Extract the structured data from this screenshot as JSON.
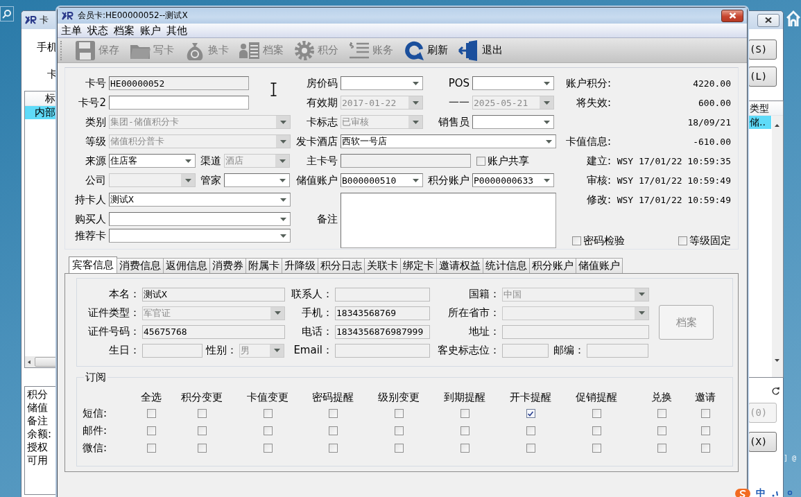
{
  "desktop": {
    "fragment": "] @",
    "ime": {
      "label": "中"
    }
  },
  "back_window": {
    "title": "卡",
    "left": {
      "labels": [
        "手机",
        "卡"
      ],
      "table": {
        "header": "标",
        "rows": [
          {
            "text": "内部",
            "selected": true
          }
        ]
      },
      "info_lines": [
        "积分",
        "储值",
        "备注",
        "余额:",
        "授权",
        "可用"
      ]
    },
    "right": {
      "top_buttons": [
        {
          "label": "(S)",
          "disabled": false
        },
        {
          "label": "(L)",
          "disabled": false
        }
      ],
      "table": {
        "header": "类型",
        "rows": [
          {
            "text": "储..",
            "selected": true
          }
        ]
      },
      "bottom_buttons": [
        {
          "label": "(0)",
          "disabled": true
        },
        {
          "label": "(X)",
          "disabled": false
        }
      ]
    }
  },
  "window": {
    "title": "会员卡:HE00000052--测试X"
  },
  "menu": [
    "主单",
    "状态",
    "档案",
    "账户",
    "其他"
  ],
  "toolbar": [
    {
      "label": "保存",
      "kind": "save",
      "disabled": true
    },
    {
      "label": "写卡",
      "kind": "folder",
      "disabled": true
    },
    {
      "label": "换卡",
      "kind": "bag",
      "disabled": true
    },
    {
      "label": "档案",
      "kind": "profile",
      "disabled": true
    },
    {
      "label": "积分",
      "kind": "gear",
      "disabled": true
    },
    {
      "label": "账务",
      "kind": "ledger",
      "disabled": true
    },
    {
      "label": "刷新",
      "kind": "refresh",
      "disabled": false
    },
    {
      "label": "退出",
      "kind": "exit",
      "disabled": false
    }
  ],
  "form": {
    "left": [
      [
        {
          "label": "卡号",
          "kind": "text",
          "value": "HE00000052",
          "readonly": true,
          "disabled": false
        }
      ],
      [
        {
          "label": "卡号2",
          "kind": "text",
          "readonly": false,
          "disabled": false
        }
      ],
      [
        {
          "label": "类别",
          "kind": "combo",
          "value": "集团-储值积分卡",
          "disabled": true
        }
      ],
      [
        {
          "label": "等级",
          "kind": "combo",
          "value": "储值积分普卡",
          "disabled": true
        }
      ],
      [
        {
          "label": "来源",
          "kind": "combo",
          "value": "住店客",
          "disabled": false
        },
        {
          "label": "渠道",
          "kind": "combo",
          "value": "酒店",
          "disabled": true
        }
      ],
      [
        {
          "label": "公司",
          "kind": "combo",
          "disabled": true
        },
        {
          "label": "管家",
          "kind": "combo",
          "disabled": false
        }
      ],
      [
        {
          "label": "持卡人",
          "kind": "combo",
          "value": "测试X",
          "disabled": false
        }
      ],
      [
        {
          "label": "购买人",
          "kind": "combo",
          "disabled": false
        }
      ],
      [
        {
          "label": "推荐卡",
          "kind": "combo",
          "disabled": false
        }
      ]
    ],
    "middle": [
      [
        {
          "label": "房价码",
          "kind": "combo",
          "disabled": false
        },
        {
          "label": "POS",
          "kind": "combo",
          "disabled": false
        }
      ],
      [
        {
          "label": "有效期",
          "kind": "combo",
          "value": "2017-01-22",
          "disabled": true
        },
        {
          "separator": "一一",
          "kind": "combo",
          "value": "2025-05-21",
          "disabled": true
        }
      ],
      [
        {
          "label": "卡标志",
          "kind": "combo",
          "value": "已审核",
          "disabled": true
        },
        {
          "label": "销售员",
          "kind": "combo",
          "disabled": false
        }
      ],
      [
        {
          "label": "发卡酒店",
          "kind": "combo",
          "value": "西软一号店",
          "disabled": false
        }
      ],
      [
        {
          "label": "主卡号",
          "kind": "text",
          "readonly": true,
          "disabled": false
        },
        {
          "kind": "checkbox",
          "label": "账户共享",
          "checked": false
        }
      ],
      [
        {
          "label": "储值账户",
          "kind": "combo",
          "value": "B000000510",
          "disabled": false
        },
        {
          "label": "积分账户",
          "kind": "combo",
          "value": "P0000000633",
          "disabled": false
        }
      ],
      [
        {
          "label": "备注",
          "kind": "textarea",
          "readonly": false,
          "disabled": false
        }
      ]
    ],
    "info": [
      {
        "label": "账户积分:",
        "value": "4220.00"
      },
      {
        "label": "将失效:",
        "value": "600.00"
      },
      {
        "value": "18/09/21"
      },
      {
        "label": "卡值信息:",
        "value": "-610.00"
      },
      {
        "label": "建立:",
        "value": "WSY 17/01/22 10:59:35"
      },
      {
        "label": "审核:",
        "value": "WSY 17/01/22 10:59:49"
      },
      {
        "label": "修改:",
        "value": "WSY 17/01/22 10:59:49"
      }
    ],
    "options": [
      {
        "label": "密码检验",
        "checked": false
      },
      {
        "label": "等级固定",
        "checked": false
      }
    ]
  },
  "tabs": [
    {
      "label": "宾客信息",
      "selected": true
    },
    {
      "label": "消费信息",
      "selected": false
    },
    {
      "label": "返佣信息",
      "selected": false
    },
    {
      "label": "消费券",
      "selected": false
    },
    {
      "label": "附属卡",
      "selected": false
    },
    {
      "label": "升降级",
      "selected": false
    },
    {
      "label": "积分日志",
      "selected": false
    },
    {
      "label": "关联卡",
      "selected": false
    },
    {
      "label": "绑定卡",
      "selected": false
    },
    {
      "label": "邀请权益",
      "selected": false
    },
    {
      "label": "统计信息",
      "selected": false
    },
    {
      "label": "积分账户",
      "selected": false
    },
    {
      "label": "储值账户",
      "selected": false
    }
  ],
  "guest": {
    "rows": [
      [
        {
          "label": "本名：",
          "kind": "text",
          "value": "测试X",
          "disabled": false
        },
        {
          "label": "联系人：",
          "kind": "text",
          "disabled": false
        },
        {
          "label": "国籍：",
          "kind": "combo",
          "value": "中国",
          "disabled": true
        }
      ],
      [
        {
          "label": "证件类型：",
          "kind": "combo",
          "value": "军官证",
          "disabled": true
        },
        {
          "label": "手机：",
          "kind": "text",
          "value": "18343568769",
          "disabled": false
        },
        {
          "label": "所在省市：",
          "kind": "combo",
          "disabled": true
        }
      ],
      [
        {
          "label": "证件号码：",
          "kind": "text",
          "value": "45675768",
          "disabled": false
        },
        {
          "label": "电话：",
          "kind": "text",
          "value": "1834356876987999",
          "disabled": false
        },
        {
          "label": "地址：",
          "kind": "text",
          "disabled": false
        }
      ],
      [
        {
          "label": "生日：",
          "kind": "text",
          "disabled": false,
          "extra": {
            "label": "性别：",
            "kind": "combo",
            "value": "男",
            "disabled": true
          }
        },
        {
          "label": "Email：",
          "kind": "text",
          "disabled": false
        },
        {
          "label": "客史标志位：",
          "kind": "text",
          "disabled": false,
          "extra": {
            "label": "邮编：",
            "kind": "text",
            "disabled": false
          }
        }
      ]
    ],
    "button": {
      "label": "档案",
      "disabled": true
    }
  },
  "subscription": {
    "title": "订阅",
    "columns": [
      "全选",
      "积分变更",
      "卡值变更",
      "密码提醒",
      "级别变更",
      "到期提醒",
      "开卡提醒",
      "促销提醒",
      "兑换",
      "邀请"
    ],
    "rows": [
      {
        "label": "短信:",
        "checks": [
          false,
          false,
          false,
          false,
          false,
          false,
          true,
          false,
          false,
          false
        ]
      },
      {
        "label": "邮件:",
        "checks": [
          false,
          false,
          false,
          false,
          false,
          false,
          false,
          false,
          false,
          false
        ]
      },
      {
        "label": "微信:",
        "checks": [
          false,
          false,
          false,
          false,
          false,
          false,
          false,
          false,
          false,
          false
        ]
      }
    ]
  }
}
